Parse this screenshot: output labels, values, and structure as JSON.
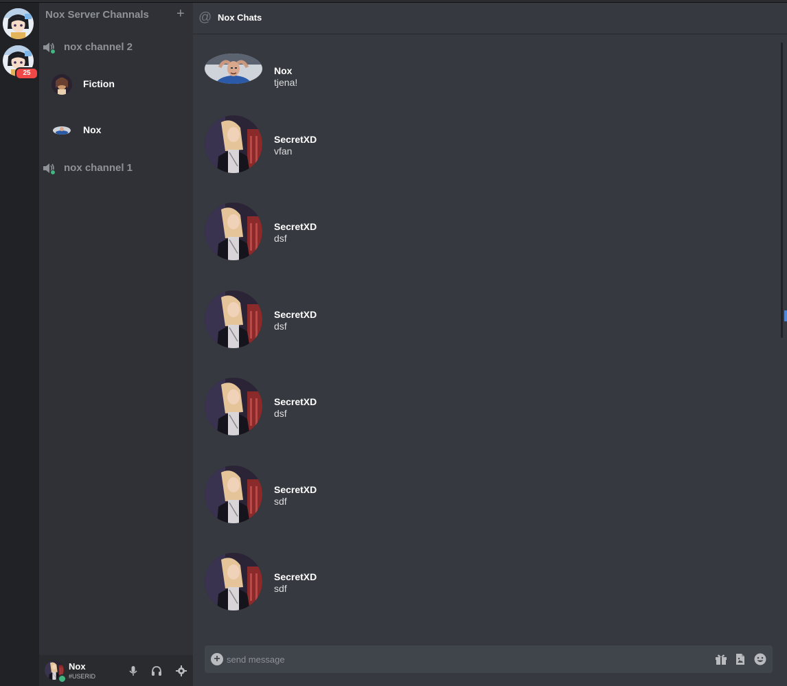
{
  "colors": {
    "rail_bg": "#202225",
    "sidebar_bg": "#2f3136",
    "chat_bg": "#36393f",
    "composer_bg": "#40444b",
    "muted_text": "#8e9297",
    "online": "#43b581",
    "badge": "#f04747"
  },
  "servers": [
    {
      "icon": "anime-server-icon"
    },
    {
      "icon": "anime-server-icon",
      "badge": "25"
    }
  ],
  "sidebar": {
    "title": "Nox Server Channals",
    "add_icon": "plus-icon",
    "channels": [
      {
        "name": "nox channel 2",
        "icon": "speaker-icon",
        "users": [
          "Fiction",
          "Nox"
        ]
      },
      {
        "name": "nox channel 1",
        "icon": "speaker-icon",
        "users": []
      }
    ]
  },
  "user_panel": {
    "name": "Nox",
    "id": "#USERID",
    "icons": [
      "microphone-icon",
      "headphones-icon",
      "settings-icon"
    ]
  },
  "chat": {
    "header_icon": "at-icon",
    "title": "Nox Chats",
    "messages": [
      {
        "author": "Nox",
        "text": "tjena!"
      },
      {
        "author": "SecretXD",
        "text": "vfan"
      },
      {
        "author": "SecretXD",
        "text": "dsf"
      },
      {
        "author": "SecretXD",
        "text": "dsf"
      },
      {
        "author": "SecretXD",
        "text": "dsf"
      },
      {
        "author": "SecretXD",
        "text": "sdf"
      },
      {
        "author": "SecretXD",
        "text": "sdf"
      }
    ]
  },
  "composer": {
    "placeholder": "send message",
    "icons": [
      "add-attachment-icon",
      "gift-icon",
      "upload-file-icon",
      "emoji-icon"
    ]
  }
}
